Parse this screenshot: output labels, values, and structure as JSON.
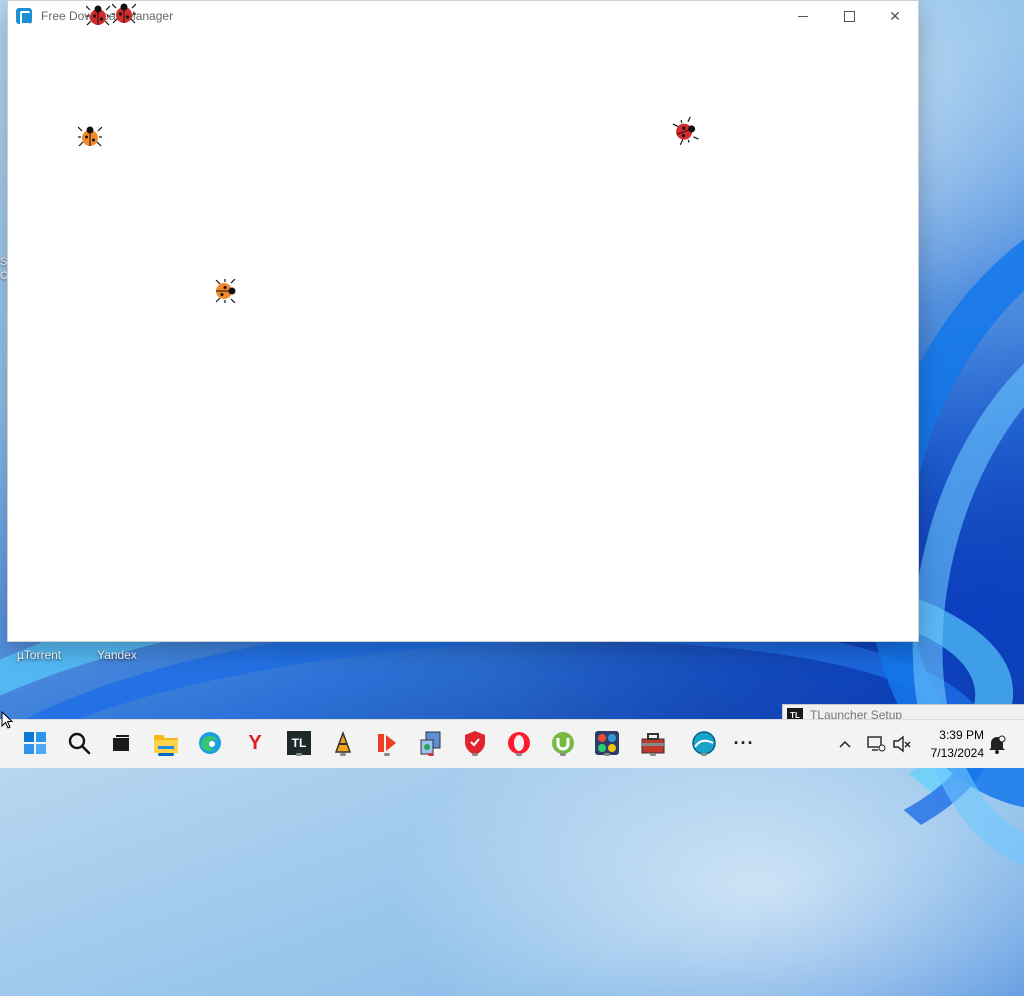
{
  "window": {
    "title": "Free Download Manager"
  },
  "desktop": {
    "icons": [
      {
        "label": "µTorrent"
      },
      {
        "label": "Yandex"
      }
    ],
    "edge_text": [
      "S",
      "C"
    ]
  },
  "notification_window": {
    "logo_text": "TL",
    "title": "TLauncher Setup"
  },
  "taskbar": {
    "apps": [
      {
        "name": "start-icon"
      },
      {
        "name": "search-icon"
      },
      {
        "name": "task-view-icon"
      },
      {
        "name": "file-explorer-icon"
      },
      {
        "name": "edge-icon"
      },
      {
        "name": "yandex-icon",
        "text": "Y"
      },
      {
        "name": "tlauncher-icon",
        "text": "TL"
      },
      {
        "name": "winamp-icon"
      },
      {
        "name": "anydesk-icon"
      },
      {
        "name": "installer-icon"
      },
      {
        "name": "shield-icon"
      },
      {
        "name": "opera-icon"
      },
      {
        "name": "utorrent-icon"
      },
      {
        "name": "grid-app-icon"
      },
      {
        "name": "toolbox-icon"
      },
      {
        "name": "aqua-app-icon"
      },
      {
        "name": "more-icon"
      }
    ],
    "tray": {
      "clock_time": "3:39 PM",
      "clock_date": "7/13/2024"
    }
  },
  "colors": {
    "accent": "#0067c0",
    "window_bg": "#ffffff",
    "taskbar_bg": "#f3f3f3"
  }
}
